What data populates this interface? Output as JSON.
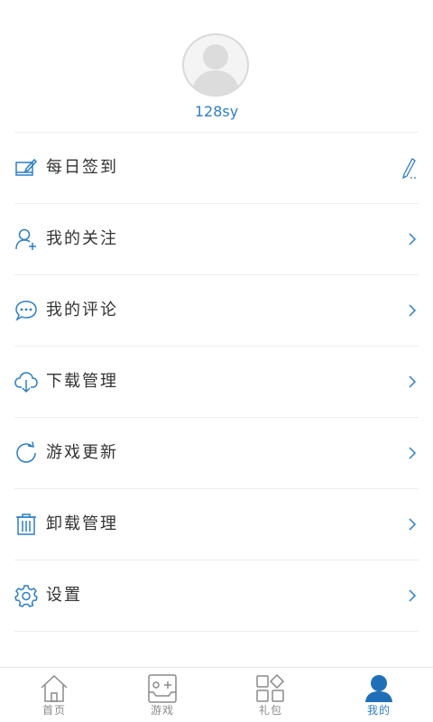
{
  "profile": {
    "username": "128sy"
  },
  "menu": {
    "items": [
      {
        "label": "每日签到",
        "icon": "sign-in-icon",
        "trailing": "pencil-icon"
      },
      {
        "label": "我的关注",
        "icon": "user-follow-icon",
        "trailing": "chevron-right-icon"
      },
      {
        "label": "我的评论",
        "icon": "comment-bubble-icon",
        "trailing": "chevron-right-icon"
      },
      {
        "label": "下载管理",
        "icon": "cloud-download-icon",
        "trailing": "chevron-right-icon"
      },
      {
        "label": "游戏更新",
        "icon": "refresh-icon",
        "trailing": "chevron-right-icon"
      },
      {
        "label": "卸载管理",
        "icon": "trash-icon",
        "trailing": "chevron-right-icon"
      },
      {
        "label": "设置",
        "icon": "gear-icon",
        "trailing": "chevron-right-icon"
      }
    ]
  },
  "tabbar": {
    "tabs": [
      {
        "label": "首页",
        "icon": "home-icon",
        "active": false
      },
      {
        "label": "游戏",
        "icon": "gamepad-icon",
        "active": false
      },
      {
        "label": "礼包",
        "icon": "grid-apps-icon",
        "active": false
      },
      {
        "label": "我的",
        "icon": "person-icon",
        "active": true
      }
    ]
  },
  "colors": {
    "accent": "#2d7ec4",
    "text": "#333333",
    "divider": "#eeeeee",
    "tab_inactive": "#8a8a8a"
  }
}
